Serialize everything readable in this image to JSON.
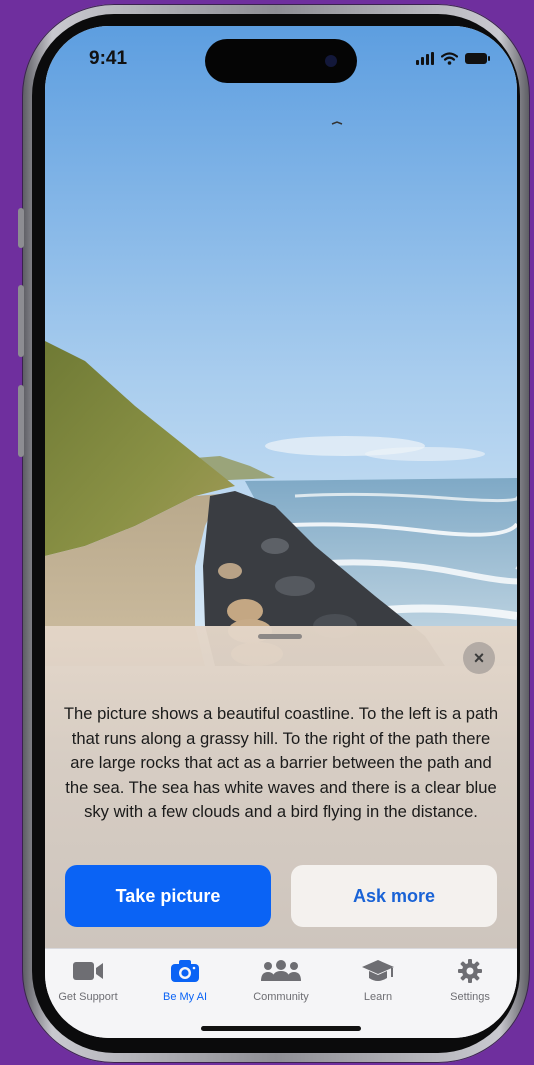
{
  "status_bar": {
    "time": "9:41",
    "icons": [
      "cellular-signal-icon",
      "wifi-icon",
      "battery-icon"
    ]
  },
  "photo": {
    "icon": "photo-scene-coastline"
  },
  "result_sheet": {
    "close_label": "×",
    "description": "The picture shows a beautiful coastline. To the left is a path that runs along a grassy hill. To the right of the path there are large rocks that act as a barrier between the path and the sea. The sea has white waves and there is a clear blue sky with a few clouds and a bird flying in the distance.",
    "primary_action": "Take picture",
    "secondary_action": "Ask more"
  },
  "tab_bar": {
    "items": [
      {
        "label": "Get Support",
        "icon": "video-camera-icon",
        "active": false
      },
      {
        "label": "Be My AI",
        "icon": "camera-icon",
        "active": true
      },
      {
        "label": "Community",
        "icon": "people-group-icon",
        "active": false
      },
      {
        "label": "Learn",
        "icon": "graduation-cap-icon",
        "active": false
      },
      {
        "label": "Settings",
        "icon": "gear-icon",
        "active": false
      }
    ]
  },
  "colors": {
    "background": "#6f2f9e",
    "primary": "#0a63f5",
    "inactive_tab": "#6e6e73"
  }
}
